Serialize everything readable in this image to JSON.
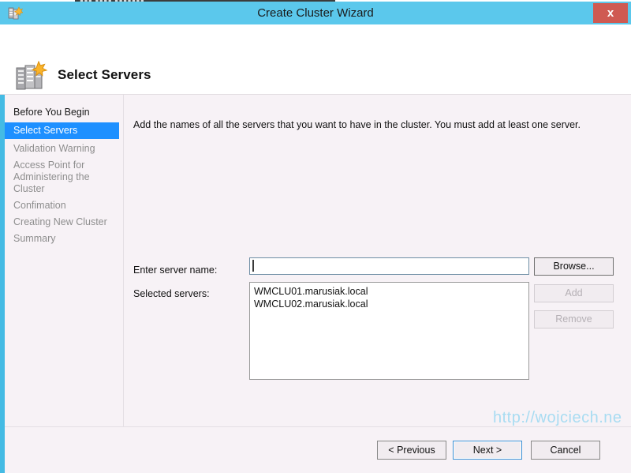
{
  "background": {
    "strip_text": "▮▮▮ ▮▮▮▮ ▮▮▮▮▮▮▮"
  },
  "titlebar": {
    "title": "Create Cluster Wizard",
    "close_label": "x",
    "icon": "cluster-server-icon",
    "bg_color": "#5BC8EC",
    "close_color": "#CF5A52"
  },
  "header": {
    "title": "Select Servers",
    "icon": "server-rack-icon"
  },
  "sidebar": {
    "accent_color": "#44BBE4",
    "active_color": "#1E90FF",
    "items": [
      {
        "label": "Before You Begin",
        "state": "completed"
      },
      {
        "label": "Select Servers",
        "state": "active"
      },
      {
        "label": "Validation Warning",
        "state": "pending"
      },
      {
        "label": "Access Point for Administering the Cluster",
        "state": "pending"
      },
      {
        "label": "Confimation",
        "state": "pending"
      },
      {
        "label": "Creating New Cluster",
        "state": "pending"
      },
      {
        "label": "Summary",
        "state": "pending"
      }
    ]
  },
  "content": {
    "instruction": "Add the names of all the servers that you want to have in the cluster. You must add at least one server.",
    "server_name_label": "Enter server name:",
    "server_name_value": "",
    "server_name_placeholder": "",
    "selected_servers_label": "Selected servers:",
    "selected_servers": [
      "WMCLU01.marusiak.local",
      "WMCLU02.marusiak.local"
    ],
    "buttons": {
      "browse": "Browse...",
      "add": "Add",
      "remove": "Remove"
    }
  },
  "footer": {
    "previous": "< Previous",
    "next": "Next >",
    "cancel": "Cancel"
  },
  "watermark": {
    "text": "http://wojciech.ne"
  }
}
